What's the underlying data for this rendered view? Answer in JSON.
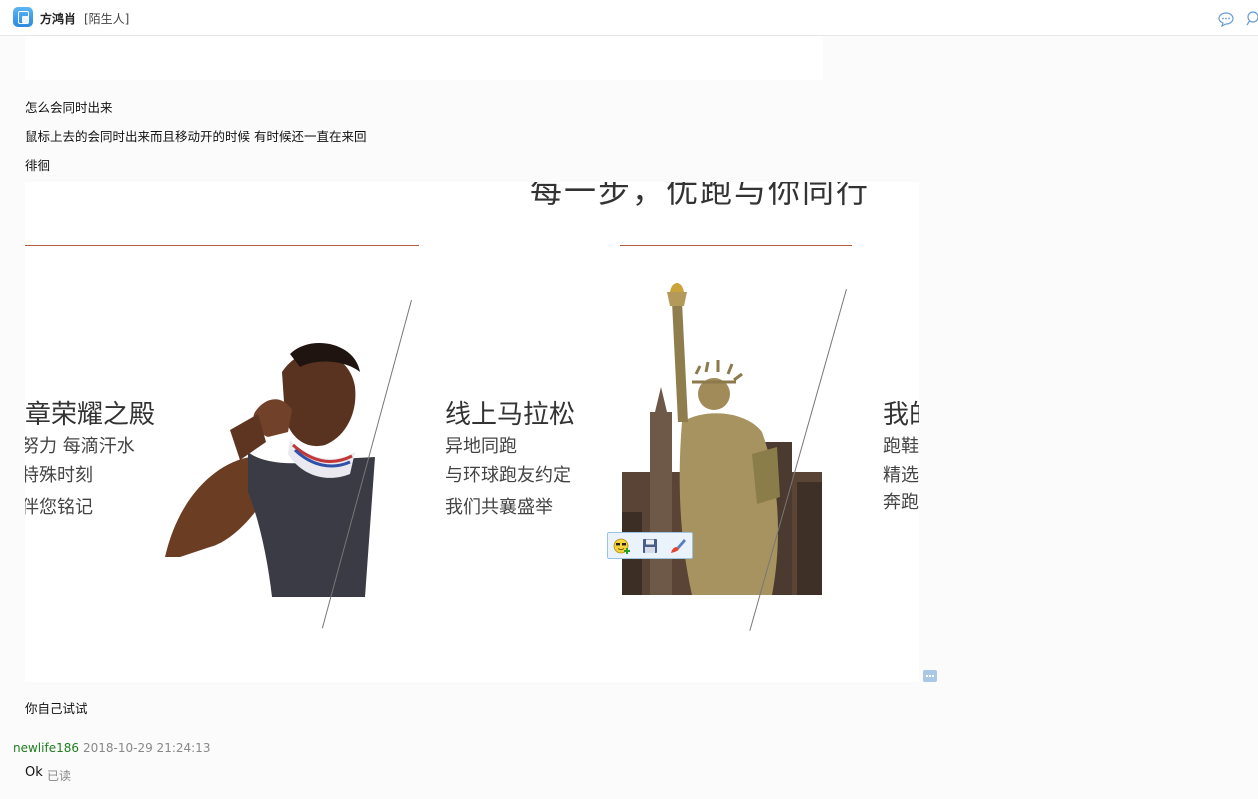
{
  "header": {
    "contact_name": "方鸿肖",
    "contact_tag": "[陌生人]"
  },
  "messages": {
    "line1": "怎么会同时出来",
    "line2": "鼠标上去的会同时出来而且移动开的时候 有时候还一直在来回",
    "line3": "徘徊",
    "line4": "你自己试试"
  },
  "image": {
    "top_title": "每一步，优跑与你同行",
    "panel1_title": "章荣耀之殿",
    "panel1_lines": [
      "努力 每滴汗水",
      "特殊时刻",
      "伴您铭记"
    ],
    "panel2_title": "线上马拉松",
    "panel2_lines": [
      "异地同跑",
      "与环球跑友约定",
      "我们共襄盛举"
    ],
    "panel3_title": "我的",
    "panel3_lines": [
      "跑鞋",
      "精选",
      "奔跑"
    ]
  },
  "reply": {
    "sender": "newlife186",
    "timestamp": "2018-10-29 21:24:13",
    "text": "Ok",
    "read_status": "已读"
  },
  "icons": {
    "app": "qq-app-icon",
    "header_right": [
      "chat-bubble-icon",
      "search-icon"
    ],
    "toolbar": [
      "add-emoji-icon",
      "save-icon",
      "edit-brush-icon"
    ]
  }
}
